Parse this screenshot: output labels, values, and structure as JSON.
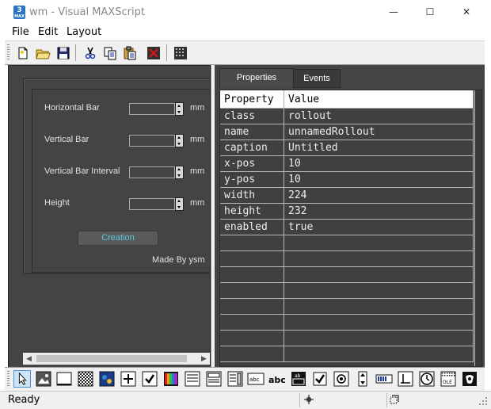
{
  "window": {
    "title": "wm - Visual MAXScript",
    "app_icon_text": "3",
    "minimize_glyph": "—",
    "maximize_glyph": "☐",
    "close_glyph": "✕"
  },
  "menu": [
    "File",
    "Edit",
    "Layout"
  ],
  "toolbar": [
    {
      "name": "new-file-icon"
    },
    {
      "name": "open-folder-icon"
    },
    {
      "name": "save-icon"
    },
    {
      "name": "cut-icon"
    },
    {
      "name": "copy-icon"
    },
    {
      "name": "paste-icon"
    },
    {
      "name": "delete-icon"
    },
    {
      "name": "grid-icon"
    }
  ],
  "rollout": {
    "fields": [
      {
        "label": "Horizontal Bar",
        "unit": "mm"
      },
      {
        "label": "Vertical Bar",
        "unit": "mm"
      },
      {
        "label": "Vertical Bar Interval",
        "unit": "mm"
      },
      {
        "label": "Height",
        "unit": "mm"
      }
    ],
    "button_label": "Creation",
    "credit": "Made By ysm"
  },
  "tabs": [
    {
      "label": "Properties",
      "active": true
    },
    {
      "label": "Events",
      "active": false
    }
  ],
  "properties": {
    "columns": [
      "Property",
      "Value"
    ],
    "rows": [
      [
        "class",
        "rollout"
      ],
      [
        "name",
        "unnamedRollout"
      ],
      [
        "caption",
        "Untitled"
      ],
      [
        "x-pos",
        "10"
      ],
      [
        "y-pos",
        "10"
      ],
      [
        "width",
        "224"
      ],
      [
        "height",
        "232"
      ],
      [
        "enabled",
        "true"
      ]
    ]
  },
  "controls_toolbar": [
    "select-arrow-icon",
    "bitmap-icon",
    "button-icon",
    "map-button-icon",
    "material-button-icon",
    "pickbutton-icon",
    "checkbutton-icon",
    "color-picker-icon",
    "combobox-icon",
    "dropdown-icon",
    "listbox-icon",
    "edittext-icon",
    "label-icon",
    "groupbox-icon",
    "checkbox-icon",
    "radiobutton-icon",
    "spinner-icon",
    "progressbar-icon",
    "slider-icon",
    "timer-icon",
    "activex-icon",
    "custom-control-icon"
  ],
  "status": {
    "text": "Ready"
  },
  "colors": {
    "panel_bg": "#444444",
    "accent_text": "#5cc8e0",
    "titlebar_bg": "#ffffff",
    "chrome_bg": "#f0f0f0"
  }
}
